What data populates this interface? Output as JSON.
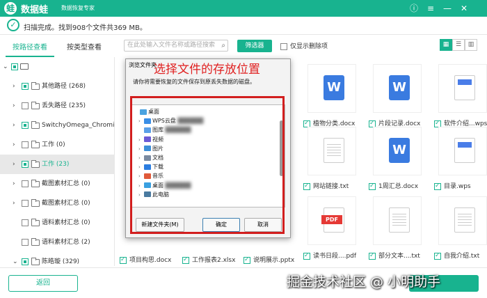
{
  "app": {
    "name": "数据蛙",
    "subtitle": "数据恢复专家",
    "logo_glyph": "蛙"
  },
  "status": {
    "text": "扫描完成。找到908个文件共369 MB。"
  },
  "tabs": [
    {
      "label": "按路径查看",
      "active": true
    },
    {
      "label": "按类型查看",
      "active": false
    }
  ],
  "search": {
    "placeholder": "在此处输入文件名称或路径搜索"
  },
  "filter_button": "筛选器",
  "only_deleted_label": "仅显示删除项",
  "tree": [
    {
      "label": "其他路径 (268)",
      "check": "partial",
      "arrow": true
    },
    {
      "label": "丢失路径 (235)",
      "check": "none",
      "arrow": true
    },
    {
      "label": "SwitchyOmega_Chromium",
      "check": "partial",
      "arrow": true
    },
    {
      "label": "工作 (0)",
      "check": "none",
      "arrow": true
    },
    {
      "label": "工作 (23)",
      "check": "partial",
      "arrow": true,
      "selected": true
    },
    {
      "label": "截图素材汇总 (0)",
      "check": "none",
      "arrow": true
    },
    {
      "label": "截图素材汇总 (0)",
      "check": "none",
      "arrow": true
    },
    {
      "label": "语料素材汇总 (0)",
      "check": "none",
      "arrow": false
    },
    {
      "label": "语料素材汇总 (2)",
      "check": "none",
      "arrow": false
    },
    {
      "label": "陈皓璇 (329)",
      "check": "partial",
      "arrow": true
    }
  ],
  "files": [
    {
      "name": "",
      "kind": "w"
    },
    {
      "name": "植物分类.docx",
      "kind": "w"
    },
    {
      "name": "片段记录.docx",
      "kind": "w"
    },
    {
      "name": "软件介绍...wps",
      "kind": "wps"
    },
    {
      "name": "网站链接.txt",
      "kind": "txt"
    },
    {
      "name": "1周汇总.docx",
      "kind": "w"
    },
    {
      "name": "目录.wps",
      "kind": "wps"
    },
    {
      "name": "读书日段....pdf",
      "kind": "pdf"
    },
    {
      "name": "部分文本....txt",
      "kind": "txt"
    },
    {
      "name": "自我介绍.txt",
      "kind": "txt"
    }
  ],
  "bottom_files": [
    {
      "name": "项目构思.docx"
    },
    {
      "name": "工作报表2.xlsx"
    },
    {
      "name": "说明展示.pptx"
    }
  ],
  "back_button": "返回",
  "watermark": "掘金技术社区 @ 小明助手",
  "dialog": {
    "title": "浏览文件夹",
    "overlay_title": "选择文件的存放位置",
    "description": "请你将需要恢复的文件保存到原丢失数据的磁盘。",
    "items": [
      {
        "label": "桌面",
        "color": "#4aa3e0",
        "indent": 0,
        "chevron": false
      },
      {
        "label": "WPS云盘",
        "color": "#3a8ee6",
        "indent": 1,
        "chevron": true
      },
      {
        "label": "图库",
        "color": "#5aa0e8",
        "indent": 1,
        "chevron": false
      },
      {
        "label": "视频",
        "color": "#6b5bd6",
        "indent": 1,
        "chevron": true
      },
      {
        "label": "图片",
        "color": "#3c8fd8",
        "indent": 1,
        "chevron": true
      },
      {
        "label": "文档",
        "color": "#7a8aa0",
        "indent": 1,
        "chevron": true
      },
      {
        "label": "下载",
        "color": "#2b7de0",
        "indent": 1,
        "chevron": true
      },
      {
        "label": "音乐",
        "color": "#e05a3a",
        "indent": 1,
        "chevron": true
      },
      {
        "label": "桌面",
        "color": "#3aa0e0",
        "indent": 1,
        "chevron": true
      },
      {
        "label": "此电脑",
        "color": "#4a7aa0",
        "indent": 1,
        "chevron": true
      }
    ],
    "new_folder_button": "新建文件夹(M)",
    "ok_button": "确定",
    "cancel_button": "取消"
  },
  "colors": {
    "brand": "#18b38f",
    "highlight_red": "#d21e1e"
  }
}
